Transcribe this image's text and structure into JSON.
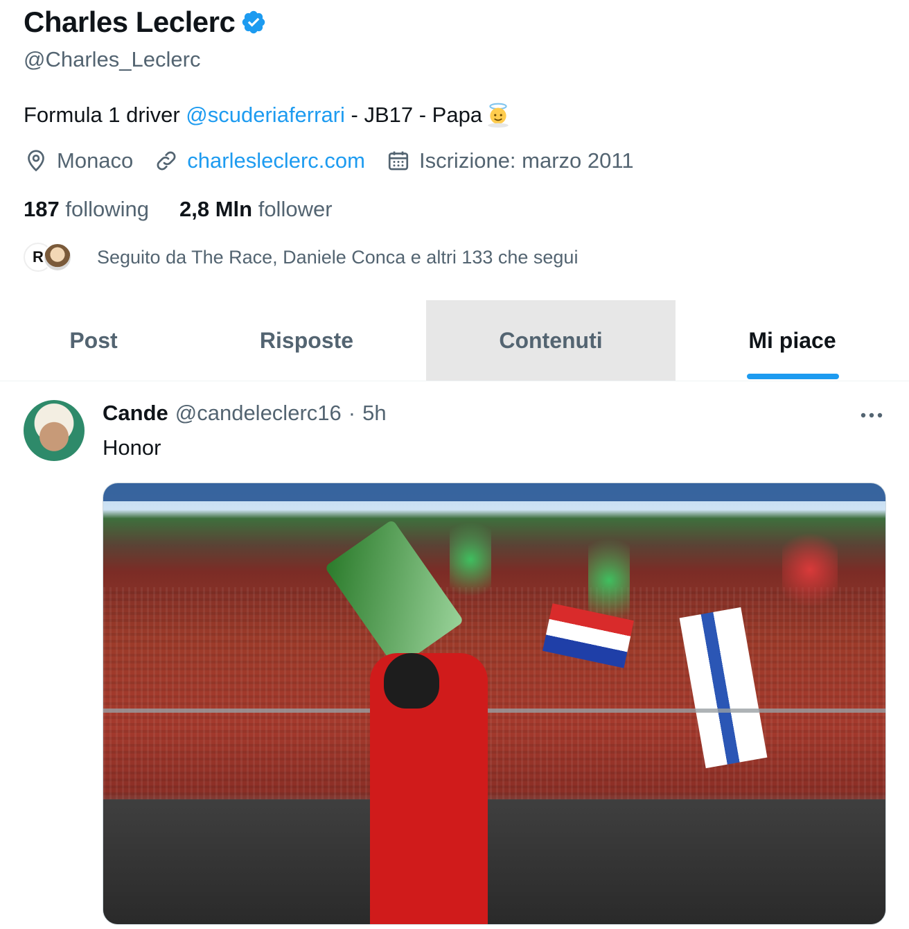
{
  "profile": {
    "display_name": "Charles Leclerc",
    "handle": "@Charles_Leclerc",
    "bio_prefix": "Formula 1 driver ",
    "bio_mention": "@scuderiaferrari",
    "bio_suffix": " - JB17 - Papa",
    "location": "Monaco",
    "website": "charlesleclerc.com",
    "joined": "Iscrizione: marzo 2011",
    "following_count": "187",
    "following_label": "following",
    "followers_count": "2,8 Mln",
    "followers_label": "follower",
    "followed_by": "Seguito da The Race, Daniele Conca e altri 133 che segui",
    "accent_color": "#1d9bf0"
  },
  "tabs": [
    {
      "label": "Post"
    },
    {
      "label": "Risposte"
    },
    {
      "label": "Contenuti"
    },
    {
      "label": "Mi piace"
    }
  ],
  "post": {
    "author_name": "Cande",
    "author_handle": "@candeleclerc16",
    "separator": "·",
    "time": "5h",
    "text": "Honor",
    "more_icon": "more-dots-icon"
  }
}
